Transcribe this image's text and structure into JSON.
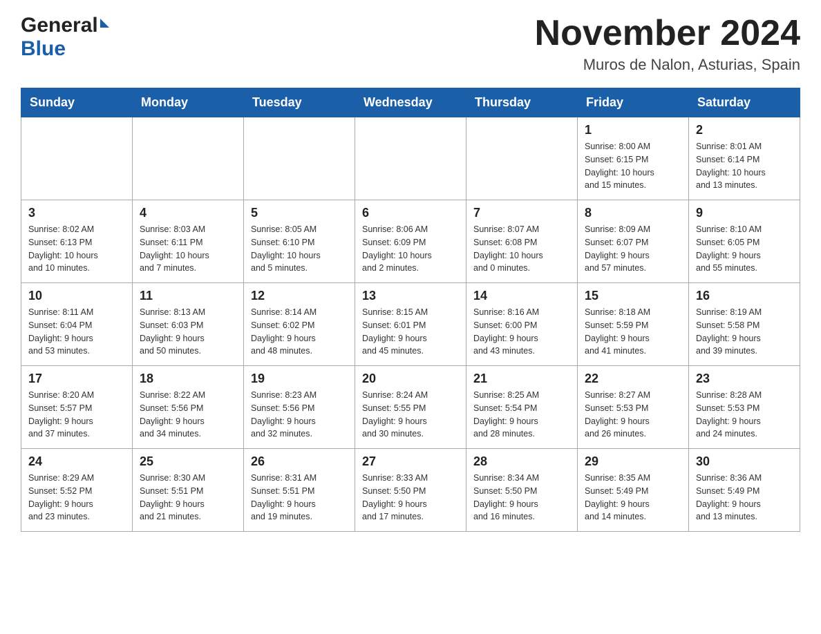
{
  "header": {
    "logo_general": "General",
    "logo_blue": "Blue",
    "month_title": "November 2024",
    "location": "Muros de Nalon, Asturias, Spain"
  },
  "weekdays": [
    "Sunday",
    "Monday",
    "Tuesday",
    "Wednesday",
    "Thursday",
    "Friday",
    "Saturday"
  ],
  "weeks": [
    [
      {
        "day": "",
        "info": ""
      },
      {
        "day": "",
        "info": ""
      },
      {
        "day": "",
        "info": ""
      },
      {
        "day": "",
        "info": ""
      },
      {
        "day": "",
        "info": ""
      },
      {
        "day": "1",
        "info": "Sunrise: 8:00 AM\nSunset: 6:15 PM\nDaylight: 10 hours\nand 15 minutes."
      },
      {
        "day": "2",
        "info": "Sunrise: 8:01 AM\nSunset: 6:14 PM\nDaylight: 10 hours\nand 13 minutes."
      }
    ],
    [
      {
        "day": "3",
        "info": "Sunrise: 8:02 AM\nSunset: 6:13 PM\nDaylight: 10 hours\nand 10 minutes."
      },
      {
        "day": "4",
        "info": "Sunrise: 8:03 AM\nSunset: 6:11 PM\nDaylight: 10 hours\nand 7 minutes."
      },
      {
        "day": "5",
        "info": "Sunrise: 8:05 AM\nSunset: 6:10 PM\nDaylight: 10 hours\nand 5 minutes."
      },
      {
        "day": "6",
        "info": "Sunrise: 8:06 AM\nSunset: 6:09 PM\nDaylight: 10 hours\nand 2 minutes."
      },
      {
        "day": "7",
        "info": "Sunrise: 8:07 AM\nSunset: 6:08 PM\nDaylight: 10 hours\nand 0 minutes."
      },
      {
        "day": "8",
        "info": "Sunrise: 8:09 AM\nSunset: 6:07 PM\nDaylight: 9 hours\nand 57 minutes."
      },
      {
        "day": "9",
        "info": "Sunrise: 8:10 AM\nSunset: 6:05 PM\nDaylight: 9 hours\nand 55 minutes."
      }
    ],
    [
      {
        "day": "10",
        "info": "Sunrise: 8:11 AM\nSunset: 6:04 PM\nDaylight: 9 hours\nand 53 minutes."
      },
      {
        "day": "11",
        "info": "Sunrise: 8:13 AM\nSunset: 6:03 PM\nDaylight: 9 hours\nand 50 minutes."
      },
      {
        "day": "12",
        "info": "Sunrise: 8:14 AM\nSunset: 6:02 PM\nDaylight: 9 hours\nand 48 minutes."
      },
      {
        "day": "13",
        "info": "Sunrise: 8:15 AM\nSunset: 6:01 PM\nDaylight: 9 hours\nand 45 minutes."
      },
      {
        "day": "14",
        "info": "Sunrise: 8:16 AM\nSunset: 6:00 PM\nDaylight: 9 hours\nand 43 minutes."
      },
      {
        "day": "15",
        "info": "Sunrise: 8:18 AM\nSunset: 5:59 PM\nDaylight: 9 hours\nand 41 minutes."
      },
      {
        "day": "16",
        "info": "Sunrise: 8:19 AM\nSunset: 5:58 PM\nDaylight: 9 hours\nand 39 minutes."
      }
    ],
    [
      {
        "day": "17",
        "info": "Sunrise: 8:20 AM\nSunset: 5:57 PM\nDaylight: 9 hours\nand 37 minutes."
      },
      {
        "day": "18",
        "info": "Sunrise: 8:22 AM\nSunset: 5:56 PM\nDaylight: 9 hours\nand 34 minutes."
      },
      {
        "day": "19",
        "info": "Sunrise: 8:23 AM\nSunset: 5:56 PM\nDaylight: 9 hours\nand 32 minutes."
      },
      {
        "day": "20",
        "info": "Sunrise: 8:24 AM\nSunset: 5:55 PM\nDaylight: 9 hours\nand 30 minutes."
      },
      {
        "day": "21",
        "info": "Sunrise: 8:25 AM\nSunset: 5:54 PM\nDaylight: 9 hours\nand 28 minutes."
      },
      {
        "day": "22",
        "info": "Sunrise: 8:27 AM\nSunset: 5:53 PM\nDaylight: 9 hours\nand 26 minutes."
      },
      {
        "day": "23",
        "info": "Sunrise: 8:28 AM\nSunset: 5:53 PM\nDaylight: 9 hours\nand 24 minutes."
      }
    ],
    [
      {
        "day": "24",
        "info": "Sunrise: 8:29 AM\nSunset: 5:52 PM\nDaylight: 9 hours\nand 23 minutes."
      },
      {
        "day": "25",
        "info": "Sunrise: 8:30 AM\nSunset: 5:51 PM\nDaylight: 9 hours\nand 21 minutes."
      },
      {
        "day": "26",
        "info": "Sunrise: 8:31 AM\nSunset: 5:51 PM\nDaylight: 9 hours\nand 19 minutes."
      },
      {
        "day": "27",
        "info": "Sunrise: 8:33 AM\nSunset: 5:50 PM\nDaylight: 9 hours\nand 17 minutes."
      },
      {
        "day": "28",
        "info": "Sunrise: 8:34 AM\nSunset: 5:50 PM\nDaylight: 9 hours\nand 16 minutes."
      },
      {
        "day": "29",
        "info": "Sunrise: 8:35 AM\nSunset: 5:49 PM\nDaylight: 9 hours\nand 14 minutes."
      },
      {
        "day": "30",
        "info": "Sunrise: 8:36 AM\nSunset: 5:49 PM\nDaylight: 9 hours\nand 13 minutes."
      }
    ]
  ]
}
